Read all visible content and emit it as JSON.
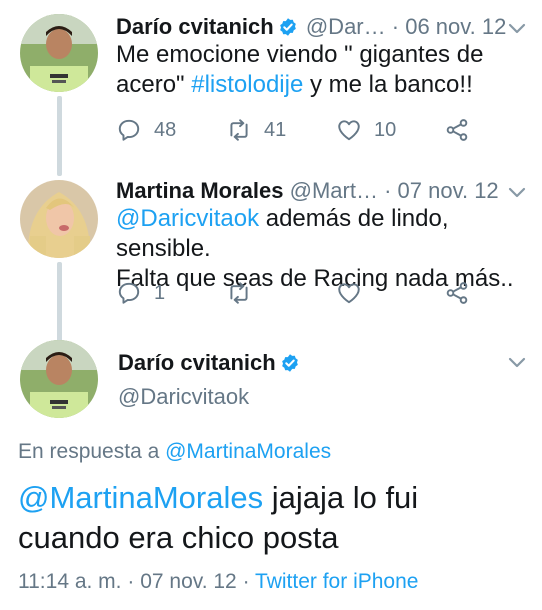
{
  "colors": {
    "link": "#1da1f2",
    "muted": "#657786",
    "text": "#14171a",
    "thread_line": "#cfd9de",
    "verified": "#1da1f2"
  },
  "tweet1": {
    "name": "Darío cvitanich",
    "handle": "@Dar…",
    "date": "06 nov. 12",
    "text_line1": "Me emocione viendo \" gigantes de",
    "text_line2_pre": "acero\" ",
    "hashtag": "#listolodije",
    "text_line2_post": " y me la banco!!",
    "replies": "48",
    "retweets": "41",
    "likes": "10"
  },
  "tweet2": {
    "name": "Martina Morales",
    "handle": "@Mart…",
    "date": "07 nov. 12",
    "mention": "@Daricvitaok",
    "text_line1_post": " además de lindo, sensible.",
    "text_line2": "Falta que seas de Racing nada más..",
    "replies": "1"
  },
  "main": {
    "name": "Darío cvitanich",
    "handle": "@Daricvitaok",
    "reply_prefix": "En respuesta a ",
    "reply_handle": "@MartinaMorales",
    "mention": "@MartinaMorales",
    "text_line1_post": " jajaja lo fui",
    "text_line2": "cuando era chico posta",
    "time": "11:14 a. m.",
    "date": "07 nov. 12",
    "source": "Twitter for iPhone"
  },
  "icons": {
    "verified": "verified-badge-icon",
    "reply": "reply-icon",
    "retweet": "retweet-icon",
    "like": "heart-icon",
    "share": "share-icon",
    "chevron": "chevron-down-icon"
  }
}
